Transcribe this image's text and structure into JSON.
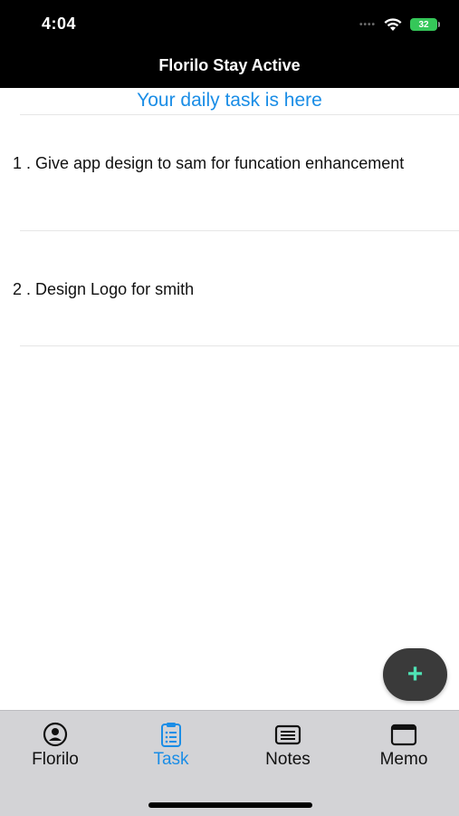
{
  "status_bar": {
    "time": "4:04",
    "battery": "32"
  },
  "header": {
    "title": "Florilo Stay Active"
  },
  "subheader": "Your daily task is here",
  "tasks": [
    {
      "label": "1 . Give app design to sam for funcation enhancement"
    },
    {
      "label": "2 . Design Logo for smith"
    }
  ],
  "fab": {
    "icon": "plus-icon",
    "symbol": "+"
  },
  "tabs": [
    {
      "label": "Florilo",
      "icon": "person-circle-icon",
      "active": false
    },
    {
      "label": "Task",
      "icon": "clipboard-list-icon",
      "active": true
    },
    {
      "label": "Notes",
      "icon": "note-icon",
      "active": false
    },
    {
      "label": "Memo",
      "icon": "window-icon",
      "active": false
    }
  ],
  "colors": {
    "accent": "#1a8de6",
    "fab_bg": "#3a3a3a",
    "fab_icon": "#4fe3b5",
    "tabbar_bg": "#d3d3d6",
    "header_bg": "#000000"
  }
}
